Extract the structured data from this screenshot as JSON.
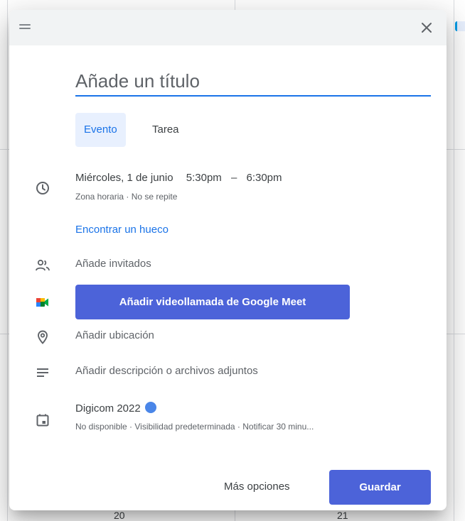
{
  "calendar_background": {
    "day_numbers": [
      "20",
      "21"
    ]
  },
  "dialog": {
    "title_input": {
      "placeholder": "Añade un título",
      "value": ""
    },
    "tabs": [
      {
        "label": "Evento",
        "active": true
      },
      {
        "label": "Tarea",
        "active": false
      }
    ],
    "datetime": {
      "date": "Miércoles, 1 de junio",
      "start": "5:30pm",
      "separator": "–",
      "end": "6:30pm",
      "subtitle": "Zona horaria · No se repite"
    },
    "find_time_link": "Encontrar un hueco",
    "guests_placeholder": "Añade invitados",
    "meet_button": "Añadir videollamada de Google Meet",
    "location_placeholder": "Añadir ubicación",
    "description_placeholder": "Añadir descripción o archivos adjuntos",
    "calendar": {
      "name": "Digicom 2022",
      "color": "#4a86e8",
      "subtitle": "No disponible · Visibilidad predeterminada · Notificar 30 minu..."
    },
    "footer": {
      "more_options": "Más opciones",
      "save": "Guardar"
    }
  },
  "colors": {
    "accent": "#1a73e8",
    "button": "#4c63d9"
  }
}
